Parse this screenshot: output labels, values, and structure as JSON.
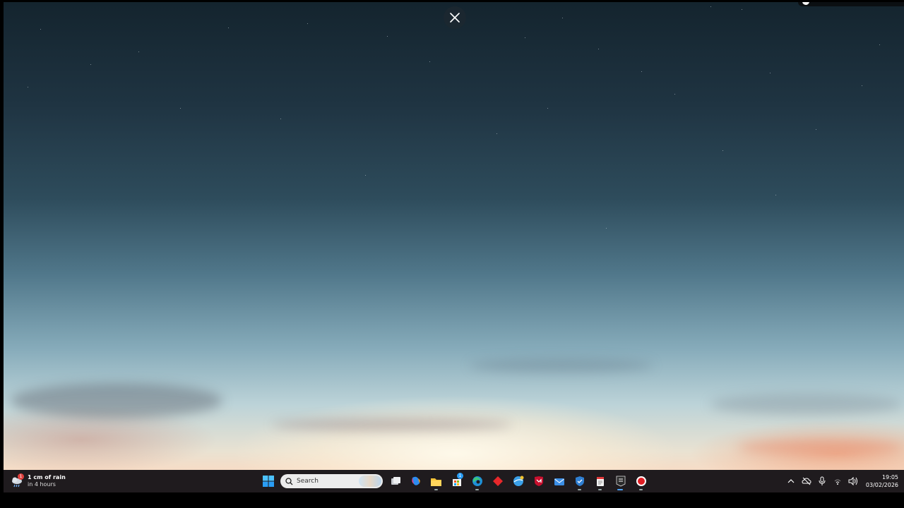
{
  "overlay": {
    "close_icon": "close-icon"
  },
  "taskbar": {
    "weather": {
      "icon": "rain-cloud-icon",
      "badge": "1",
      "headline": "1 cm of rain",
      "subline": "in 4 hours"
    },
    "search": {
      "placeholder": "Search",
      "icon": "search-icon"
    },
    "pinned": [
      {
        "name": "start-button",
        "icon": "windows-logo-icon"
      },
      {
        "name": "task-view-button",
        "icon": "task-view-icon"
      },
      {
        "name": "copilot-button",
        "icon": "copilot-icon"
      },
      {
        "name": "file-explorer-button",
        "icon": "folder-icon"
      },
      {
        "name": "store-button",
        "icon": "store-icon",
        "badge": "1"
      },
      {
        "name": "edge-button",
        "icon": "edge-icon"
      },
      {
        "name": "app-red-diamond-button",
        "icon": "red-diamond-icon"
      },
      {
        "name": "app-blue-globe-button",
        "icon": "globe-icon"
      },
      {
        "name": "mcafee-button",
        "icon": "mcafee-shield-icon"
      },
      {
        "name": "mail-button",
        "icon": "mail-icon"
      },
      {
        "name": "security-button",
        "icon": "shield-icon"
      },
      {
        "name": "notepad-button",
        "icon": "notepad-icon"
      },
      {
        "name": "epic-games-button",
        "icon": "epic-games-icon"
      },
      {
        "name": "record-button",
        "icon": "record-icon"
      }
    ],
    "tray": {
      "icons": [
        "chevron-up-icon",
        "onedrive-off-icon",
        "microphone-icon",
        "wifi-icon",
        "volume-icon"
      ],
      "time": "19:05",
      "date": "03/02/2026"
    }
  },
  "colors": {
    "taskbar": "#1f1b1e",
    "accent": "#0078d4"
  }
}
